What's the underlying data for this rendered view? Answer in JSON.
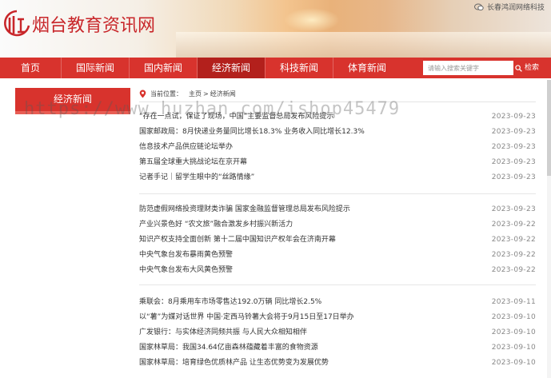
{
  "header": {
    "site_title": "烟台教育资讯网",
    "company": "长春鸿润网络科技"
  },
  "nav": {
    "items": [
      "首页",
      "国际新闻",
      "国内新闻",
      "经济新闻",
      "科技新闻",
      "体育新闻"
    ],
    "active_index": 3,
    "search_placeholder": "请输入搜索关键字",
    "search_label": "检索"
  },
  "sidebar": {
    "category": "经济新闻"
  },
  "breadcrumb": {
    "label": "当前位置：",
    "home": "主页",
    "separator": ">",
    "current": "经济新闻"
  },
  "groups": [
    [
      {
        "title": "“存在一点试，保证了现场，中国”主要监督总局发布风险提示",
        "date": "2023-09-23"
      },
      {
        "title": "国家邮政局：8月快递业务量同比增长18.3% 业务收入同比增长12.3%",
        "date": "2023-09-23"
      },
      {
        "title": "信息技术产品供应链论坛举办",
        "date": "2023-09-23"
      },
      {
        "title": "第五届全球重大挑战论坛在京开幕",
        "date": "2023-09-23"
      },
      {
        "title": "记者手记｜留学生眼中的“丝路情缘”",
        "date": "2023-09-23"
      }
    ],
    [
      {
        "title": "防范虚假网络投资理财类诈骗 国家金融监督管理总局发布风险提示",
        "date": "2023-09-23"
      },
      {
        "title": "产业兴景色好 “农文旅”融合激发乡村振兴新活力",
        "date": "2023-09-22"
      },
      {
        "title": "知识产权支持全面创新 第十二届中国知识产权年会在济南开幕",
        "date": "2023-09-22"
      },
      {
        "title": "中央气象台发布暴雨黄色预警",
        "date": "2023-09-22"
      },
      {
        "title": "中央气象台发布大风黄色预警",
        "date": "2023-09-22"
      }
    ],
    [
      {
        "title": "乘联会：8月乘用车市场零售达192.0万辆 同比增长2.5%",
        "date": "2023-09-11"
      },
      {
        "title": "以“薯”为媒对话世界 中国·定西马铃薯大会将于9月15日至17日举办",
        "date": "2023-09-10"
      },
      {
        "title": "广发银行：与实体经济同频共振 与人民大众相知相伴",
        "date": "2023-09-10"
      },
      {
        "title": "国家林草局：我国34.64亿亩森林蕴藏着丰富的食物资源",
        "date": "2023-09-10"
      },
      {
        "title": "国家林草局：培育绿色优质林产品 让生态优势变为发展优势",
        "date": "2023-09-10"
      }
    ]
  ],
  "watermark": "https://www.huzhan.com/ishop45479",
  "colors": {
    "brand_red": "#d8332d",
    "active_red": "#b3201c"
  }
}
